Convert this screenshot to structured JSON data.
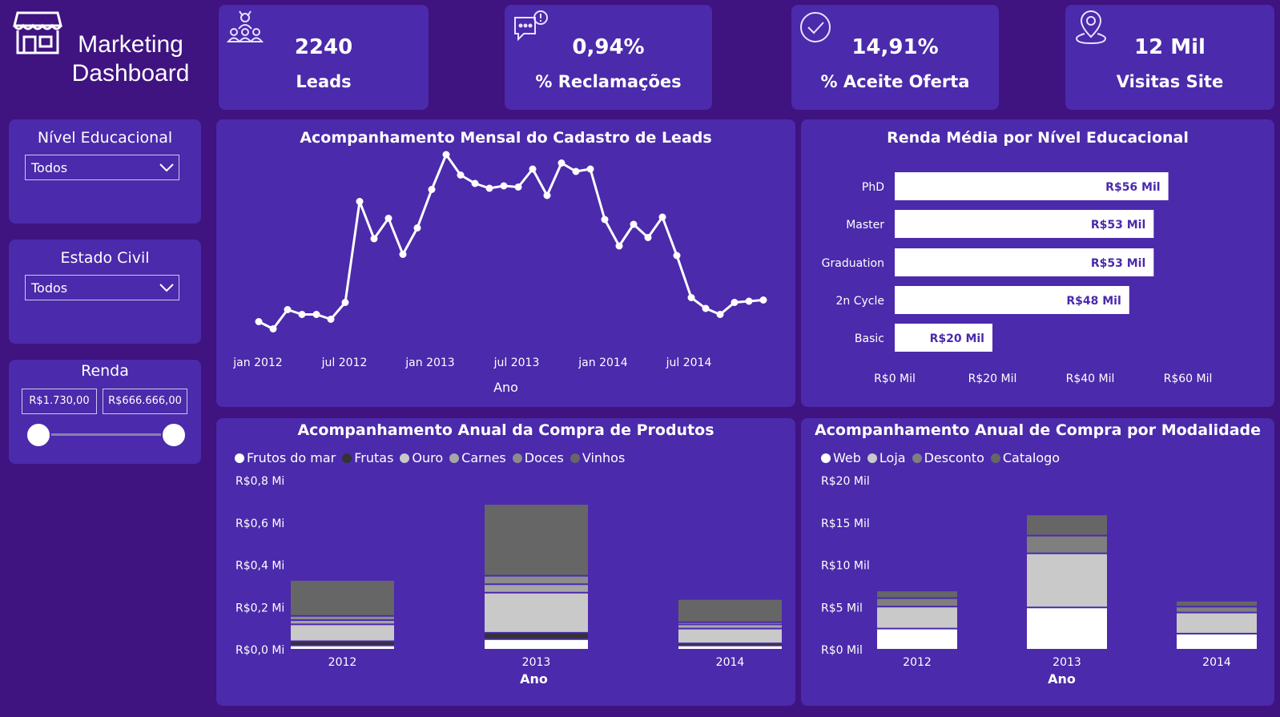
{
  "header": {
    "title_line1": "Marketing",
    "title_line2": "Dashboard",
    "icon": "store-icon"
  },
  "kpis": [
    {
      "value": "2240",
      "label": "Leads",
      "icon": "people-group-icon"
    },
    {
      "value": "0,94%",
      "label": "% Reclamações",
      "icon": "chat-alert-icon"
    },
    {
      "value": "14,91%",
      "label": "% Aceite Oferta",
      "icon": "check-circle-icon"
    },
    {
      "value": "12 Mil",
      "label": "Visitas Site",
      "icon": "map-pin-icon"
    }
  ],
  "filters": {
    "education": {
      "title": "Nível Educacional",
      "value": "Todos"
    },
    "marital": {
      "title": "Estado Civil",
      "value": "Todos"
    },
    "income": {
      "title": "Renda",
      "min": "R$1.730,00",
      "max": "R$666.666,00",
      "range_fraction": [
        0,
        1
      ]
    }
  },
  "colors": {
    "background": "#3f1380",
    "card": "#4b2aab",
    "white": "#ffffff",
    "light_gray": "#c9c9c9",
    "mid_gray": "#a6a6a6",
    "dark_gray": "#666666",
    "near_black": "#333333",
    "gray": "#7f7f7f"
  },
  "chart_data": [
    {
      "type": "line",
      "title": "Acompanhamento Mensal do Cadastro de Leads",
      "xlabel": "Ano",
      "x_ticks": [
        "jan 2012",
        "jul 2012",
        "jan 2013",
        "jul 2013",
        "jan 2014",
        "jul 2014"
      ],
      "x": [
        "2012-07",
        "2012-08",
        "2012-09",
        "2012-10",
        "2012-11",
        "2012-12",
        "2013-01",
        "2013-02",
        "2013-03",
        "2013-04",
        "2013-05",
        "2013-06",
        "2013-07",
        "2013-08",
        "2013-09",
        "2013-10",
        "2013-11",
        "2013-12",
        "2014-01",
        "2014-02",
        "2014-03",
        "2014-04",
        "2014-05",
        "2014-06",
        "2014-07",
        "2014-08",
        "2014-09",
        "2014-10",
        "2014-11",
        "2014-12",
        "2015-01",
        "2015-02",
        "2015-03",
        "2015-04",
        "2015-05",
        "2015-06"
      ],
      "values": [
        40,
        34,
        50,
        46,
        46,
        42,
        56,
        140,
        109,
        126,
        96,
        118,
        150,
        179,
        162,
        155,
        151,
        153,
        152,
        167,
        145,
        172,
        165,
        167,
        125,
        103,
        121,
        110,
        127,
        95,
        60,
        51,
        46,
        56,
        57,
        58
      ],
      "ylim": [
        25,
        185
      ],
      "grid": false,
      "legend": "none"
    },
    {
      "type": "bar",
      "orientation": "horizontal",
      "title": "Renda Média por Nível Educacional",
      "categories": [
        "PhD",
        "Master",
        "Graduation",
        "2n Cycle",
        "Basic"
      ],
      "values": [
        56,
        53,
        53,
        48,
        20
      ],
      "data_labels": [
        "R$56 Mil",
        "R$53 Mil",
        "R$53 Mil",
        "R$48 Mil",
        "R$20 Mil"
      ],
      "x_ticks": [
        "R$0 Mil",
        "R$20 Mil",
        "R$40 Mil",
        "R$60 Mil"
      ],
      "xlim": [
        0,
        60
      ],
      "unit": "R$ Mil"
    },
    {
      "type": "bar",
      "stacked": true,
      "title": "Acompanhamento Anual da Compra de Produtos",
      "xlabel": "Ano",
      "categories": [
        "2012",
        "2013",
        "2014"
      ],
      "y_ticks": [
        "R$0,0 Mi",
        "R$0,2 Mi",
        "R$0,4 Mi",
        "R$0,6 Mi",
        "R$0,8 Mi"
      ],
      "ylim": [
        0,
        0.8
      ],
      "unit": "R$ Mi",
      "legend": "top-left",
      "series": [
        {
          "name": "Frutos do mar",
          "color": "#ffffff",
          "values": [
            0.02,
            0.05,
            0.02
          ]
        },
        {
          "name": "Frutas",
          "color": "#333333",
          "values": [
            0.02,
            0.03,
            0.01
          ]
        },
        {
          "name": "Ouro",
          "color": "#c9c9c9",
          "values": [
            0.08,
            0.19,
            0.07
          ]
        },
        {
          "name": "Carnes",
          "color": "#a6a6a6",
          "values": [
            0.02,
            0.04,
            0.02
          ]
        },
        {
          "name": "Doces",
          "color": "#8c8c8c",
          "values": [
            0.02,
            0.04,
            0.01
          ]
        },
        {
          "name": "Vinhos",
          "color": "#666666",
          "values": [
            0.17,
            0.34,
            0.11
          ]
        }
      ]
    },
    {
      "type": "bar",
      "stacked": true,
      "title": "Acompanhamento Anual de Compra por Modalidade",
      "xlabel": "Ano",
      "categories": [
        "2012",
        "2013",
        "2014"
      ],
      "y_ticks": [
        "R$0 Mil",
        "R$5 Mil",
        "R$10 Mil",
        "R$15 Mil",
        "R$20 Mil"
      ],
      "ylim": [
        0,
        20
      ],
      "unit": "R$ Mil",
      "legend": "top-left",
      "series": [
        {
          "name": "Web",
          "color": "#ffffff",
          "values": [
            2.5,
            5.0,
            1.9
          ]
        },
        {
          "name": "Loja",
          "color": "#c9c9c9",
          "values": [
            2.6,
            6.4,
            2.5
          ]
        },
        {
          "name": "Desconto",
          "color": "#7f7f7f",
          "values": [
            1.0,
            2.1,
            0.7
          ]
        },
        {
          "name": "Catalogo",
          "color": "#666666",
          "values": [
            0.9,
            2.5,
            0.7
          ]
        }
      ]
    }
  ]
}
